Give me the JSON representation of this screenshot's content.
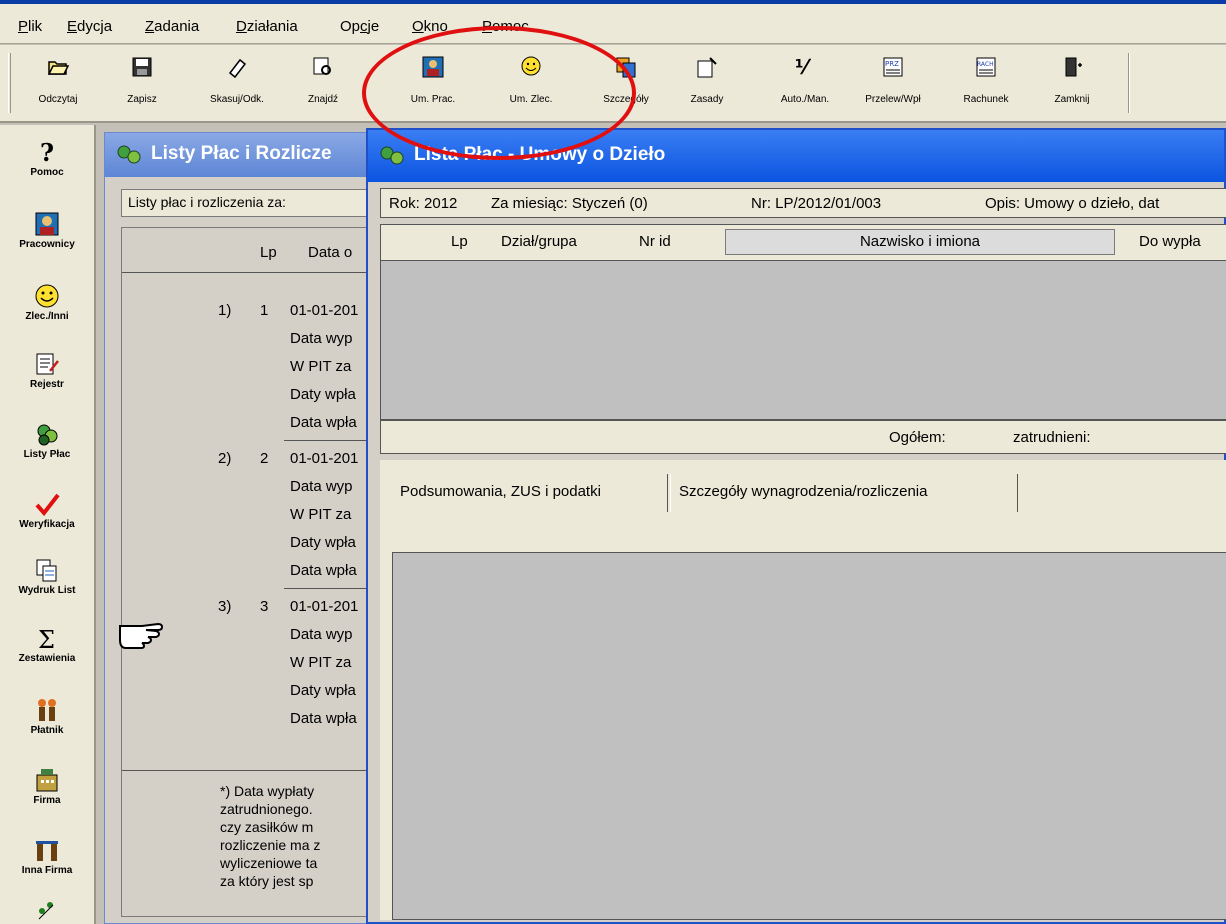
{
  "menu": {
    "items": [
      {
        "pre": "",
        "ul": "P",
        "post": "lik"
      },
      {
        "pre": "",
        "ul": "E",
        "post": "dycja"
      },
      {
        "pre": "",
        "ul": "Z",
        "post": "adania"
      },
      {
        "pre": "",
        "ul": "D",
        "post": "ziałania"
      },
      {
        "pre": "Op",
        "ul": "c",
        "post": "je"
      },
      {
        "pre": "",
        "ul": "O",
        "post": "kno"
      },
      {
        "pre": "",
        "ul": "P",
        "post": "omoc"
      }
    ]
  },
  "toolbar": {
    "buttons": [
      {
        "label": "Odczytaj",
        "icon": "folder-open-icon"
      },
      {
        "label": "Zapisz",
        "icon": "save-icon"
      },
      {
        "label": "Skasuj/Odk.",
        "icon": "eraser-icon"
      },
      {
        "label": "Znajdź",
        "icon": "find-icon"
      },
      {
        "label": "Um. Prac.",
        "icon": "employee-contract-icon"
      },
      {
        "label": "Um. Zlec.",
        "icon": "order-contract-icon"
      },
      {
        "label": "Szczegóły",
        "icon": "details-icon"
      },
      {
        "label": "Zasady",
        "icon": "rules-icon"
      },
      {
        "label": "Auto./Man.",
        "icon": "auto-manual-icon"
      },
      {
        "label": "Przelew/Wpł",
        "icon": "transfer-icon"
      },
      {
        "label": "Rachunek",
        "icon": "bill-icon"
      },
      {
        "label": "Zamknij",
        "icon": "close-door-icon"
      }
    ]
  },
  "sidebar": {
    "items": [
      {
        "label": "Pomoc",
        "icon": "help-icon"
      },
      {
        "label": "Pracownicy",
        "icon": "employees-icon"
      },
      {
        "label": "Zlec./Inni",
        "icon": "smiley-icon"
      },
      {
        "label": "Rejestr",
        "icon": "register-icon"
      },
      {
        "label": "Listy Płac",
        "icon": "payroll-icon"
      },
      {
        "label": "Weryfikacja",
        "icon": "checkmark-icon"
      },
      {
        "label": "Wydruk List",
        "icon": "print-lists-icon"
      },
      {
        "label": "Zestawienia",
        "icon": "sigma-icon"
      },
      {
        "label": "Płatnik",
        "icon": "platnik-icon"
      },
      {
        "label": "Firma",
        "icon": "company-icon"
      },
      {
        "label": "Inna Firma",
        "icon": "other-company-icon"
      },
      {
        "label": "",
        "icon": "more-icon"
      }
    ]
  },
  "back_window": {
    "title": "Listy Płac i Rozlicze",
    "header_field": "Listy płac i rozliczenia za:  ",
    "columns": {
      "lp": "Lp",
      "date": "Data o"
    },
    "groups": [
      {
        "num": "1)",
        "lp": "1",
        "date": "01-01-201",
        "rows": [
          "Data wyp",
          "W PIT za",
          "Daty wpła",
          "Data wpła"
        ]
      },
      {
        "num": "2)",
        "lp": "2",
        "date": "01-01-201",
        "rows": [
          "Data wyp",
          "W PIT za",
          "Daty wpła",
          "Data wpła"
        ]
      },
      {
        "num": "3)",
        "lp": "3",
        "date": "01-01-201",
        "rows": [
          "Data wyp",
          "W PIT za",
          "Daty wpła",
          "Data wpła"
        ]
      }
    ],
    "note_lines": [
      "*) Data wypłaty",
      "zatrudnionego.",
      "czy zasiłków m",
      "rozliczenie ma z",
      "wyliczeniowe ta",
      "za który jest sp"
    ]
  },
  "front_window": {
    "title": "Lista Płac - Umowy o Dzieło",
    "info": {
      "rok": "Rok: 2012",
      "miesiac": "Za miesiąc: Styczeń (0)",
      "nr": "Nr: LP/2012/01/003",
      "opis": "Opis:  Umowy o dzieło, dat"
    },
    "grid_columns": {
      "lp": "Lp",
      "dzial": "Dział/grupa",
      "nrid": "Nr id",
      "nazwisko": "Nazwisko i imiona",
      "dowyp": "Do wypła"
    },
    "footer": {
      "ogolem": "Ogółem:",
      "zatrudnieni": "zatrudnieni:"
    },
    "tabs": [
      "Podsumowania, ZUS i podatki",
      "Szczegóły wynagrodzenia/rozliczenia"
    ]
  },
  "colors": {
    "title_active": "#0a54e0",
    "title_inactive": "#7a9ee0",
    "annotation": "#e01010"
  }
}
